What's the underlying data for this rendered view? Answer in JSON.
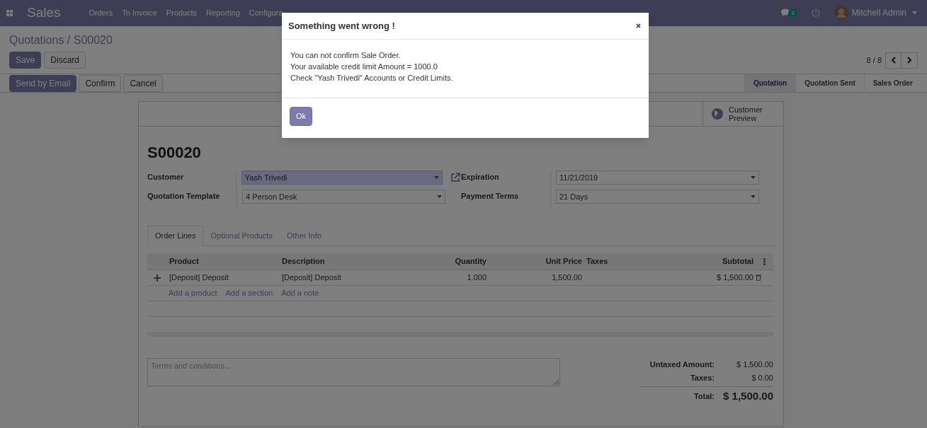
{
  "app": {
    "name": "Sales",
    "menu": [
      "Orders",
      "To Invoice",
      "Products",
      "Reporting",
      "Configura"
    ],
    "messages_count": "3",
    "user": "Mitchell Admin"
  },
  "breadcrumb": "Quotations / S00020",
  "edit_buttons": [
    {
      "label": "Save",
      "kind": "primary"
    },
    {
      "label": "Discard",
      "kind": "secondary"
    }
  ],
  "pager": "8 / 8",
  "actions": [
    {
      "label": "Send by Email",
      "kind": "primary"
    },
    {
      "label": "Confirm",
      "kind": "secondary"
    },
    {
      "label": "Cancel",
      "kind": "secondary"
    }
  ],
  "stages": [
    {
      "label": "Quotation",
      "selected": true
    },
    {
      "label": "Quotation Sent",
      "selected": false
    },
    {
      "label": "Sales Order",
      "selected": false
    }
  ],
  "smart_button": "Customer Preview",
  "record": {
    "name": "S00020",
    "fields_left": [
      {
        "label": "Customer",
        "value": "Yash Trivedi",
        "highlighted": true,
        "link": true
      },
      {
        "label": "Quotation Template",
        "value": "4 Person Desk",
        "highlighted": false,
        "link": false
      }
    ],
    "fields_right": [
      {
        "label": "Expiration",
        "value": "11/21/2019",
        "highlighted": false,
        "link": false
      },
      {
        "label": "Payment Terms",
        "value": "21 Days",
        "highlighted": false,
        "link": false
      }
    ]
  },
  "tabs": [
    {
      "label": "Order Lines",
      "selected": true
    },
    {
      "label": "Optional Products",
      "selected": false
    },
    {
      "label": "Other Info",
      "selected": false
    }
  ],
  "table": {
    "columns": [
      {
        "label": "Product",
        "kind": "text"
      },
      {
        "label": "Description",
        "kind": "text"
      },
      {
        "label": "Quantity",
        "kind": "number"
      },
      {
        "label": "Unit Price",
        "kind": "number"
      },
      {
        "label": "Taxes",
        "kind": "text"
      },
      {
        "label": "Subtotal",
        "kind": "number"
      }
    ],
    "rows": [
      {
        "cells": [
          "[Deposit] Deposit",
          "[Deposit] Deposit",
          "1.000",
          "1,500.00",
          "",
          "$ 1,500.00"
        ]
      }
    ],
    "add_links": [
      "Add a product",
      "Add a section",
      "Add a note"
    ]
  },
  "terms_placeholder": "Terms and conditions...",
  "totals": [
    {
      "label": "Untaxed Amount:",
      "value": "$ 1,500.00",
      "kind": "normal"
    },
    {
      "label": "Taxes:",
      "value": "$ 0.00",
      "kind": "normal"
    },
    {
      "label": "Total:",
      "value": "$ 1,500.00",
      "kind": "grand"
    }
  ],
  "dialog": {
    "title": "Something went wrong !",
    "lines": [
      "You can not confirm Sale Order.",
      "Your available credit limit Amount = 1000.0",
      "Check \"Yash Trivedi\" Accounts or Credit Limits."
    ],
    "button": "Ok"
  }
}
